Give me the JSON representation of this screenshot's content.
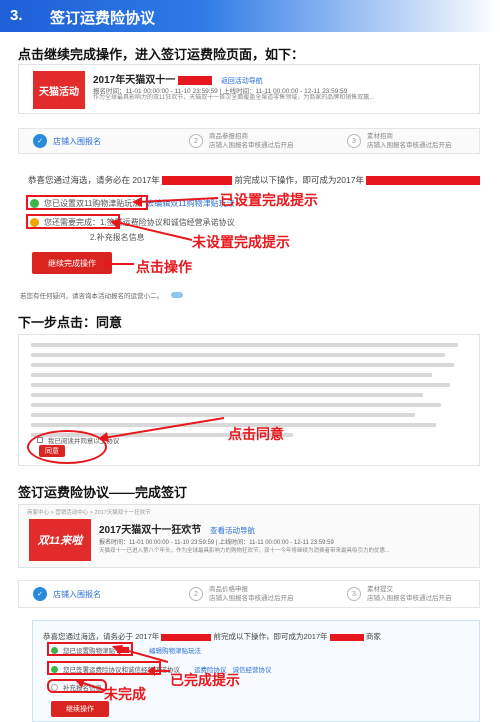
{
  "header": {
    "number": "3.",
    "title": "签订运费险协议"
  },
  "captions": {
    "c1": "点击继续完成操作，进入签订运费险页面，如下：",
    "c2": "下一步点击：同意",
    "c3": "签订运费险协议——完成签订"
  },
  "shot1": {
    "logo": "天猫活动",
    "event_title": "2017年天猫双十一",
    "nav_link": "返回活动导航",
    "meta": "报名时间：11-01 00:00:00 - 11-10 23:59:59  |  上线时间：11-11 00:00:00 - 12-11 23:59:59",
    "desc": "作为全球最具影响力的双11狂欢节，天猫双十一首次全面覆盖全渠道零售领域，为商家的品牌和销售双赢..."
  },
  "steps1": {
    "s1": "店铺入围报名",
    "s2": "商品参报招商",
    "s2sub": "店铺入围报名审核通过后开启",
    "s3": "素材招商",
    "s3sub": "店铺入围报名审核通过后开启"
  },
  "shot2": {
    "intro": "恭喜您通过海选，请务必在 2017年",
    "intro_tail": "前完成以下操作，即可成为2017年",
    "done_item": "您已设置双11购物津贴玩法",
    "done_link": "去编辑双11购物津贴玩法",
    "todo_item": "您还需要完成：1.签署运费险协议和诚信经营承诺协议",
    "todo_item2": "2.补充报名信息",
    "continue_btn": "继续完成操作",
    "footnote": "若您有任何疑问，请咨询本活动报名的运营小二。"
  },
  "annotations": {
    "a1": "已设置完成提示",
    "a2": "未设置完成提示",
    "a3": "点击操作",
    "a4": "点击同意",
    "a5": "已完成提示",
    "a6": "未完成"
  },
  "shot3": {
    "agree_label": "我已阅读并同意以上协议",
    "agree_btn": "同意"
  },
  "shot4": {
    "breadcrumb": "商家中心 > 营销活动中心 > 2017天猫双十一狂欢节",
    "logo": "双11来啦",
    "event_title": "2017天猫双十一狂欢节",
    "nav_link": "查看活动导航",
    "meta": "报名时间：11-01 00:00:00 - 11-10 23:59:59  |  上线时间：11-11 00:00:00 - 12-11 23:59:59",
    "desc": "天猫双十一已进入第八个年头，作为全球最具影响力的购物狂欢节，双十一今年将继续为消费者带来最具吸引力的优惠..."
  },
  "steps2": {
    "s1": "店铺入围报名",
    "s2": "商品价格申报",
    "s2sub": "店铺入围报名审核通过后开启",
    "s3": "素材提交",
    "s3sub": "店铺入围报名审核通过后开启"
  },
  "shot5": {
    "intro": "恭喜您通过海选，请务必于 2017年",
    "intro_mid": "前完成以下操作，即可成为2017年",
    "intro_tail": "商家",
    "item1": "您已设置购物津贴",
    "item1_link": "编辑购物津贴玩法",
    "item2": "您已签署运费险协议和诚信经营承诺协议",
    "item2_link1": "运费险协议",
    "item2_link2": "诚信经营协议",
    "item3": "补充报名信息",
    "continue_btn": "继续操作"
  }
}
